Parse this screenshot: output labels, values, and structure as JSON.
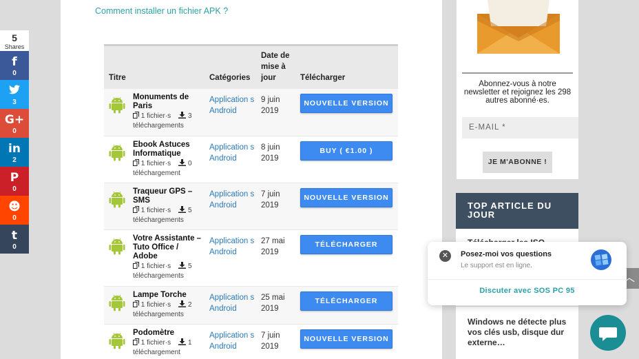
{
  "share": {
    "count": "5",
    "label": "Shares",
    "buttons": [
      {
        "icon": "facebook-icon",
        "glyph": "f",
        "count": "0",
        "color": "#3b5998"
      },
      {
        "icon": "twitter-icon",
        "glyph": "🐦",
        "count": "3",
        "color": "#1da1f2"
      },
      {
        "icon": "google-plus-icon",
        "glyph": "G+",
        "count": "0",
        "color": "#dd4b39"
      },
      {
        "icon": "linkedin-icon",
        "glyph": "in",
        "count": "2",
        "color": "#0077b5"
      },
      {
        "icon": "pinterest-icon",
        "glyph": "P",
        "count": "0",
        "color": "#cb2027"
      },
      {
        "icon": "reddit-icon",
        "glyph": "☻",
        "count": "0",
        "color": "#ff4500"
      },
      {
        "icon": "tumblr-icon",
        "glyph": "t",
        "count": "0",
        "color": "#35465c"
      }
    ]
  },
  "main": {
    "apk_link": "Comment installer un fichier APK ?",
    "table": {
      "headers": {
        "title": "Titre",
        "categories": "Catégories",
        "date": "Date de mise à jour",
        "download": "Télécharger"
      },
      "rows": [
        {
          "name": "Monuments de Paris",
          "files": "1 fichier·s",
          "downloads": "3",
          "downloads_label": "téléchargements",
          "category": "Application s Android",
          "date": "9 juin 2019",
          "button": "NOUVELLE VERSION"
        },
        {
          "name": "Ebook Astuces Informatique",
          "files": "1 fichier·s",
          "downloads": "0",
          "downloads_label": "téléchargement",
          "category": "Application s Android",
          "date": "8 juin 2019",
          "button": "BUY ( €1.00 )"
        },
        {
          "name": "Traqueur GPS – SMS",
          "files": "1 fichier·s",
          "downloads": "5",
          "downloads_label": "téléchargements",
          "category": "Application s Android",
          "date": "7 juin 2019",
          "button": "NOUVELLE VERSION"
        },
        {
          "name": "Votre Assistante – Tuto Office / Adobe",
          "files": "1 fichier·s",
          "downloads": "5",
          "downloads_label": "téléchargements",
          "category": "Application s Android",
          "date": "27 mai 2019",
          "button": "TÉLÉCHARGER"
        },
        {
          "name": "Lampe Torche",
          "files": "1 fichier·s",
          "downloads": "2",
          "downloads_label": "téléchargements",
          "category": "Application s Android",
          "date": "25 mai 2019",
          "button": "TÉLÉCHARGER"
        },
        {
          "name": "Podomètre",
          "files": "1 fichier·s",
          "downloads": "1",
          "downloads_label": "téléchargement",
          "category": "Application s Android",
          "date": "7 juin 2019",
          "button": "NOUVELLE VERSION"
        }
      ]
    }
  },
  "sidebar": {
    "newsletter_text": "Abonnez-vous à notre newsletter et rejoignez les 298 autres abonné·es.",
    "email_placeholder": "E-MAIL *",
    "subscribe": "JE M'ABONNE !",
    "top_title": "TOP ARTICLE DU JOUR",
    "article1": "Télécharger les ISO",
    "article2": "Windows ne détecte plus vos clés usb, disque dur externe…"
  },
  "chat": {
    "title": "Posez-moi vos questions",
    "status": "Le support est en ligne.",
    "link": "Discuter avec SOS PC 95"
  },
  "colors": {
    "accent": "#3d8bf0",
    "link": "#2ea3a3",
    "sidebar_header": "#3d4f61",
    "chat": "#1b8d95"
  }
}
